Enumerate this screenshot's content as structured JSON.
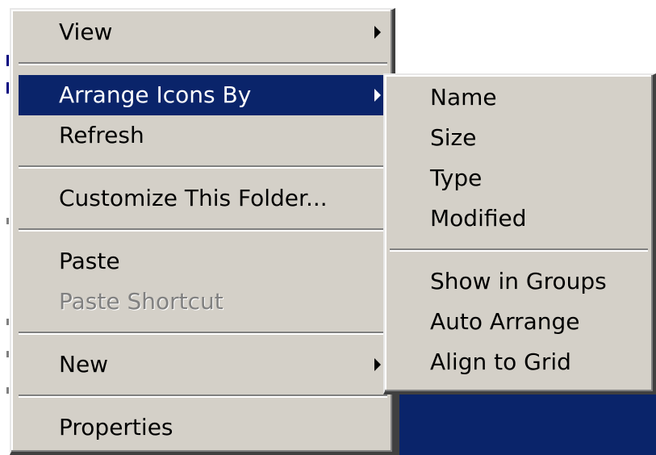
{
  "context_menu": {
    "items": [
      {
        "label": "View"
      },
      {
        "label": "Arrange Icons By"
      },
      {
        "label": "Refresh"
      },
      {
        "label": "Customize This Folder..."
      },
      {
        "label": "Paste"
      },
      {
        "label": "Paste Shortcut"
      },
      {
        "label": "New"
      },
      {
        "label": "Properties"
      }
    ]
  },
  "submenu": {
    "items": [
      {
        "label": "Name"
      },
      {
        "label": "Size"
      },
      {
        "label": "Type"
      },
      {
        "label": "Modified"
      },
      {
        "label": "Show in Groups"
      },
      {
        "label": "Auto Arrange"
      },
      {
        "label": "Align to Grid"
      }
    ]
  },
  "colors": {
    "menu_bg": "#d4d0c8",
    "highlight_bg": "#0a246a",
    "highlight_text": "#ffffff",
    "disabled_text": "#808080"
  },
  "icons": {
    "submenu_arrow": "triangle-right"
  }
}
